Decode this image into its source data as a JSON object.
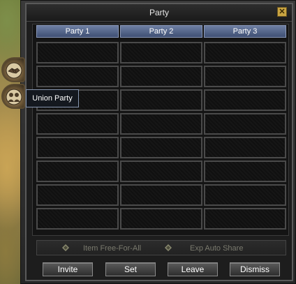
{
  "window": {
    "title": "Party",
    "close_symbol": "✕"
  },
  "columns": [
    {
      "label": "Party 1"
    },
    {
      "label": "Party 2"
    },
    {
      "label": "Party 3"
    }
  ],
  "slots_per_column": 8,
  "side_tabs": [
    {
      "icon": "handshake-icon"
    },
    {
      "icon": "union-party-icon"
    }
  ],
  "tooltip": "Union Party",
  "options": {
    "item": "Item Free-For-All",
    "exp": "Exp Auto Share"
  },
  "buttons": {
    "invite": "Invite",
    "set": "Set",
    "leave": "Leave",
    "dismiss": "Dismiss"
  },
  "colors": {
    "header": "#4f6088",
    "close": "#c9a441",
    "option_text": "#7a7a6e"
  }
}
